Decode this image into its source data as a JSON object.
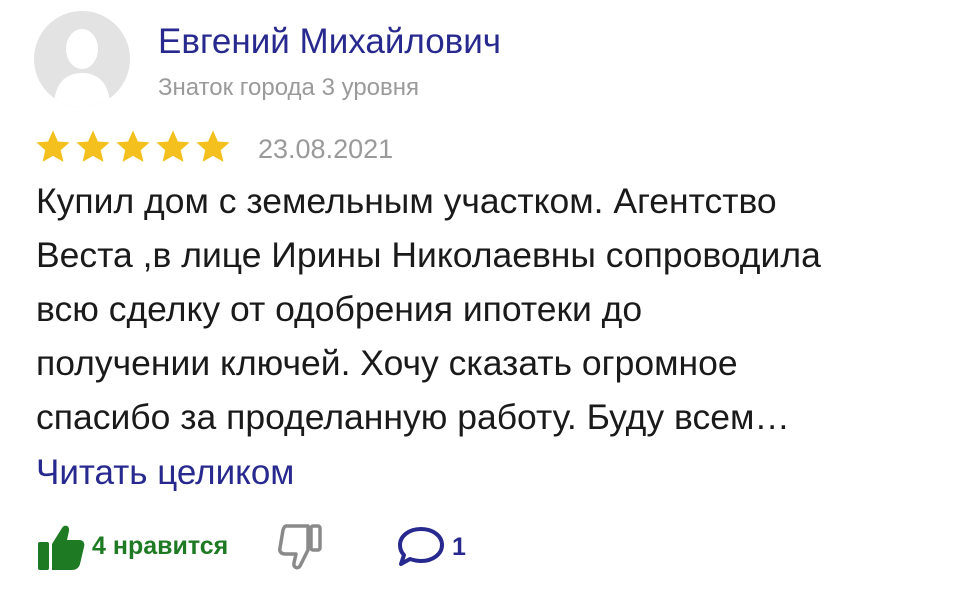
{
  "author": {
    "name": "Евгений Михайлович",
    "level": "Знаток города 3 уровня",
    "avatar_icon": "default-user-silhouette"
  },
  "rating": {
    "value": 5,
    "max": 5,
    "star_color": "#f4c01e"
  },
  "date": "23.08.2021",
  "review": {
    "lines": [
      "Купил дом с земельным участком. Агентство",
      "Веста ,в лице Ирины Николаевны сопроводила",
      "всю сделку от одобрения ипотеки до",
      "получении ключей. Хочу сказать огромное",
      "спасибо за проделанную работу. Буду всем…"
    ],
    "read_more_label": "Читать целиком"
  },
  "actions": {
    "like": {
      "icon": "thumbs-up-icon",
      "label": "4 нравится",
      "color": "#1f7a24"
    },
    "dislike": {
      "icon": "thumbs-down-icon"
    },
    "comments": {
      "icon": "speech-bubble-icon",
      "count": "1",
      "color": "#28298f"
    }
  }
}
